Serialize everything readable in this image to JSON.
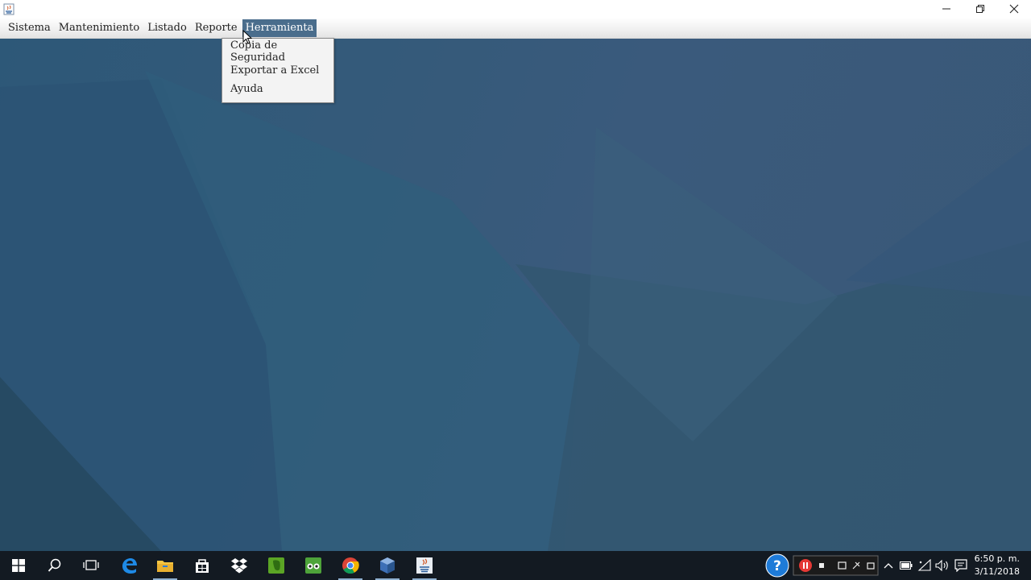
{
  "titlebar": {
    "app_icon": "java-icon",
    "controls": [
      "minimize-icon",
      "restore-icon",
      "close-icon"
    ]
  },
  "menubar": {
    "items": [
      {
        "label": "Sistema"
      },
      {
        "label": "Mantenimiento"
      },
      {
        "label": "Listado"
      },
      {
        "label": "Reporte"
      },
      {
        "label": "Herramienta",
        "active": true
      }
    ]
  },
  "dropdown": {
    "items": [
      {
        "label": "Copia de Seguridad"
      },
      {
        "label": "Exportar a Excel"
      },
      {
        "label": "Ayuda"
      }
    ]
  },
  "colors": {
    "menu_active": "#4a6d8c",
    "desktop": "#2f4f6b",
    "taskbar": "#131a22"
  },
  "taskbar": {
    "pinned": [
      "windows-start-icon",
      "search-icon",
      "task-view-icon",
      "edge-icon",
      "file-explorer-icon",
      "store-icon",
      "dropbox-icon",
      "evernote-icon",
      "tripadvisor-icon",
      "chrome-icon",
      "virtualbox-icon",
      "java-icon"
    ],
    "tray": [
      "help-icon",
      "recorder-pause-icon",
      "stop-icon",
      "camera-icon",
      "draw-icon",
      "window-icon",
      "chevron-up-icon",
      "battery-icon",
      "wifi-icon",
      "volume-icon",
      "notifications-icon"
    ],
    "clock": {
      "time": "6:50 p. m.",
      "date": "3/11/2018"
    }
  }
}
